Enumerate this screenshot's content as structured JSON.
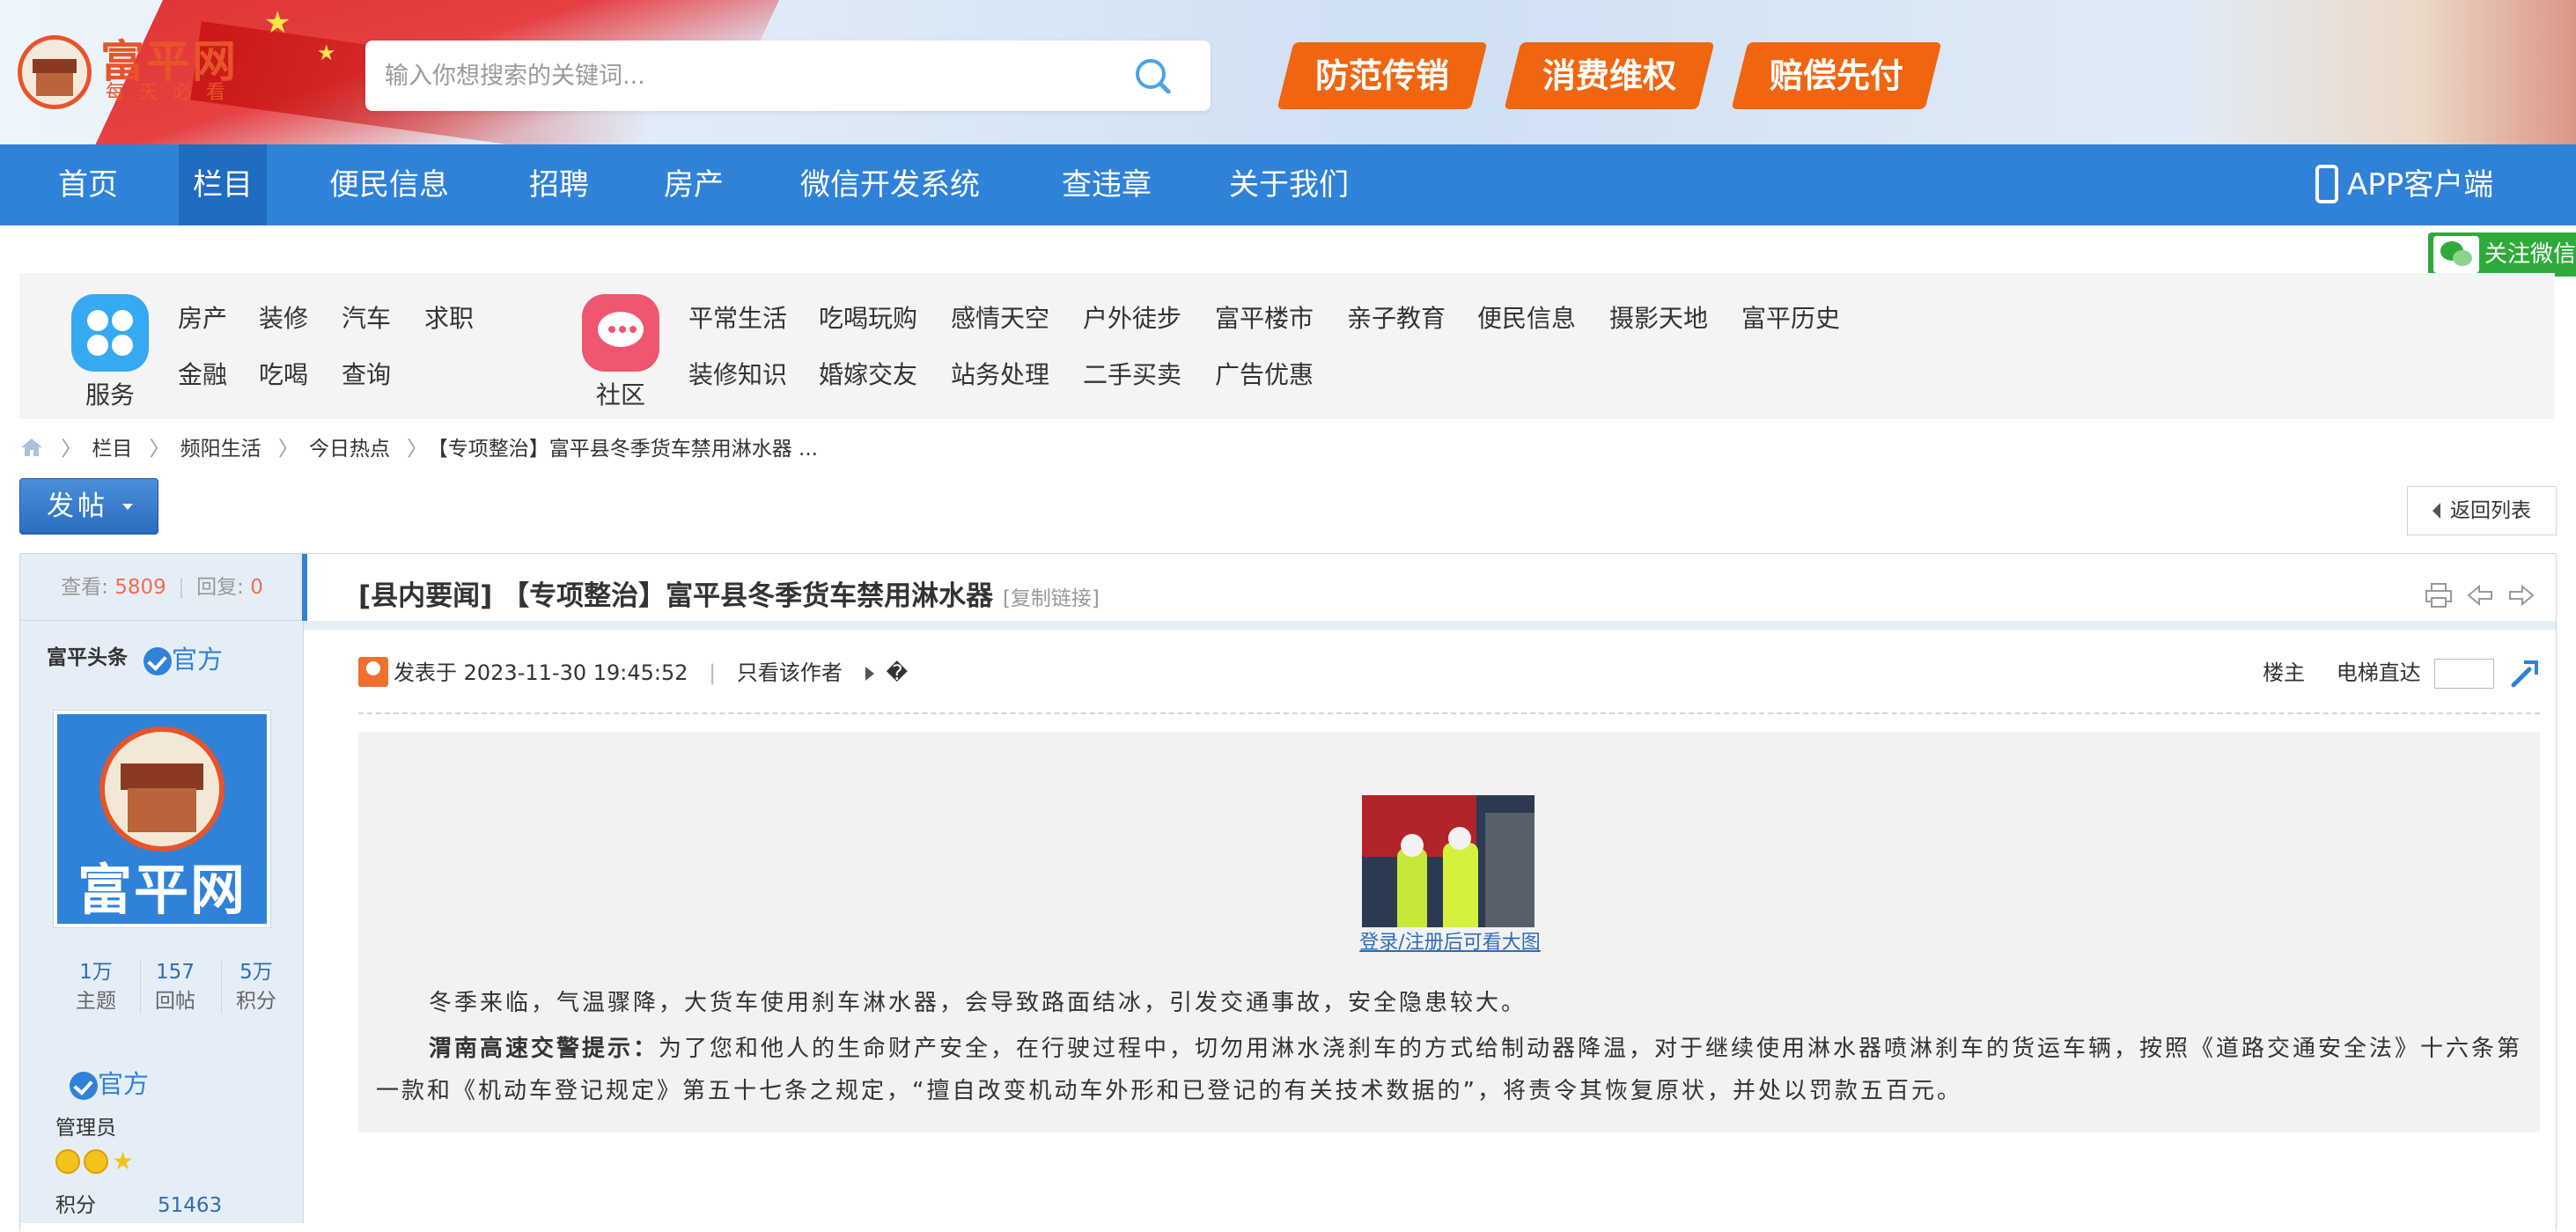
{
  "header": {
    "logo_name": "富平网",
    "logo_slogan": "每天必看",
    "search_placeholder": "输入你想搜索的关键词...",
    "promos": [
      "防范传销",
      "消费维权",
      "赔偿先付"
    ]
  },
  "nav": {
    "items": [
      "首页",
      "栏目",
      "便民信息",
      "招聘",
      "房产",
      "微信开发系统",
      "查违章",
      "关于我们"
    ],
    "active": "栏目",
    "app_client": "APP客户端"
  },
  "follow_wechat": "关注微信",
  "categories": {
    "service": {
      "title": "服务",
      "links": [
        "房产",
        "装修",
        "汽车",
        "求职",
        "金融",
        "吃喝",
        "查询"
      ]
    },
    "community": {
      "title": "社区",
      "links_row1": [
        "平常生活",
        "吃喝玩购",
        "感情天空",
        "户外徒步",
        "富平楼市",
        "亲子教育",
        "便民信息",
        "摄影天地",
        "富平历史"
      ],
      "links_row2": [
        "装修知识",
        "婚嫁交友",
        "站务处理",
        "二手买卖",
        "广告优惠"
      ]
    }
  },
  "breadcrumb": [
    "栏目",
    "频阳生活",
    "今日热点",
    "【专项整治】富平县冬季货车禁用淋水器 ..."
  ],
  "actions": {
    "post_button": "发帖",
    "return_list": "返回列表"
  },
  "stats": {
    "views_label": "查看:",
    "views": "5809",
    "replies_label": "回复:",
    "replies": "0"
  },
  "author": {
    "name": "富平头条",
    "badge": "官方",
    "avatar_text": "富平网",
    "stats": [
      {
        "value": "1万",
        "label": "主题"
      },
      {
        "value": "157",
        "label": "回帖"
      },
      {
        "value": "5万",
        "label": "积分"
      }
    ],
    "badge2": "官方",
    "role": "管理员",
    "points_label": "积分",
    "points_value": "51463"
  },
  "thread": {
    "title": "[县内要闻] 【专项整治】富平县冬季货车禁用淋水器",
    "copy_link": "[复制链接]",
    "posted_label": "发表于 2023-11-30 19:45:52",
    "author_only": "只看该作者",
    "unknown_glyph": "�",
    "floor_label": "楼主",
    "elevator_label": "电梯直达",
    "image_caption": "登录/注册后可看大图",
    "para1": "冬季来临，气温骤降，大货车使用刹车淋水器，会导致路面结冰，引发交通事故，安全隐患较大。",
    "para2_bold": "渭南高速交警提示：",
    "para2_rest": "为了您和他人的生命财产安全，在行驶过程中，切勿用淋水浇刹车的方式给制动器降温，对于继续使用淋水器喷淋刹车的货运车辆，按照《道路交通安全法》十六条第一款和《机动车登记规定》第五十七条之规定，“擅自改变机动车外形和已登记的有关技术数据的”，将责令其恢复原状，并处以罚款五百元。"
  },
  "colors": {
    "nav_blue": "#2f82d8",
    "promo_orange": "#f0650f",
    "brand_red": "#e8542a",
    "stat_number": "#f26c4f",
    "link_blue": "#2f6db5",
    "wechat_green": "#2eaa3a"
  },
  "icons": [
    "search-icon",
    "phone-icon",
    "wechat-icon",
    "service-icon",
    "community-icon",
    "home-icon",
    "verify-icon",
    "print-icon",
    "prev-icon",
    "next-icon",
    "poster-icon",
    "go-icon"
  ]
}
